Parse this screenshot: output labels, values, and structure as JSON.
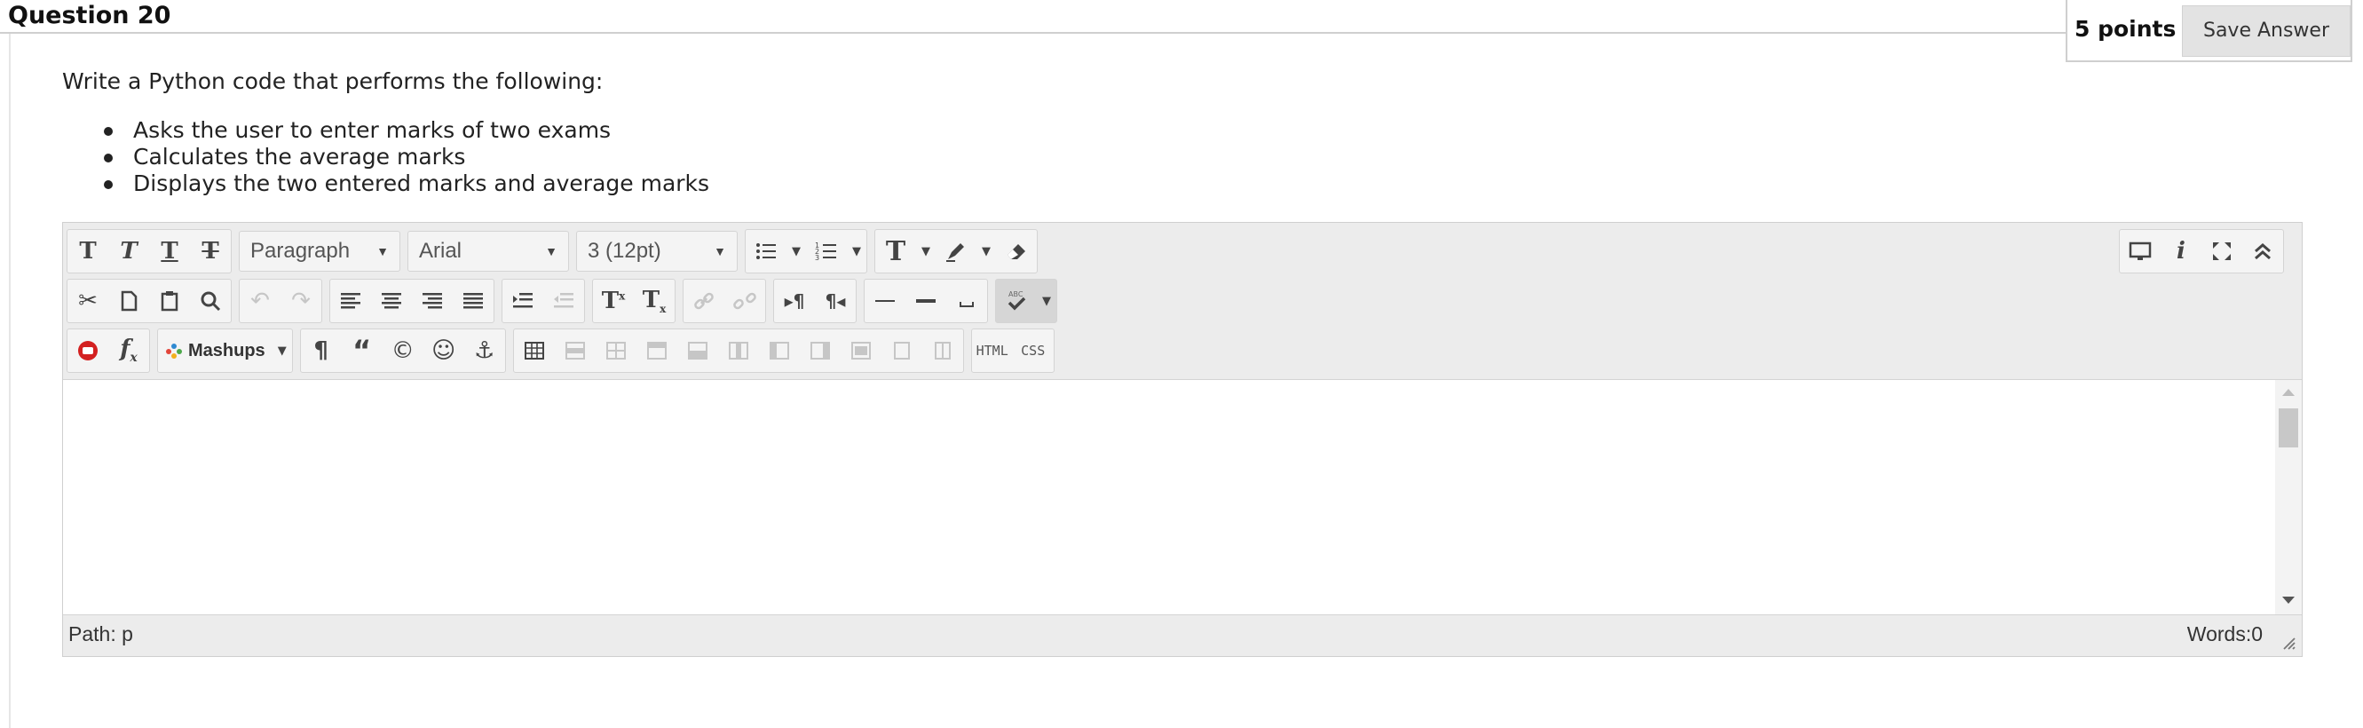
{
  "question": {
    "title": "Question 20",
    "points": "5 points",
    "save_label": "Save Answer",
    "prompt": "Write a Python code that performs the following:",
    "bullets": [
      "Asks the user to enter marks of two exams",
      "Calculates the average marks",
      "Displays the two entered marks and average marks"
    ]
  },
  "editor": {
    "format_select": "Paragraph",
    "font_select": "Arial",
    "size_select": "3 (12pt)",
    "mashups_label": "Mashups",
    "html_label": "HTML",
    "css_label": "CSS",
    "path_label": "Path: p",
    "words_label": "Words:0"
  },
  "colors": {
    "toolbar_bg": "#ececec",
    "button_bg": "#e3e3e3",
    "youtube_red": "#d32020"
  },
  "icons": [
    "bold-icon",
    "italic-icon",
    "underline-icon",
    "strikethrough-icon",
    "bullet-list-icon",
    "numbered-list-icon",
    "text-color-icon",
    "highlight-icon",
    "eraser-icon",
    "preview-icon",
    "info-icon",
    "fullscreen-icon",
    "collapse-icon",
    "cut-icon",
    "copy-icon",
    "paste-icon",
    "find-icon",
    "undo-icon",
    "redo-icon",
    "align-left-icon",
    "align-center-icon",
    "align-right-icon",
    "justify-icon",
    "indent-icon",
    "outdent-icon",
    "superscript-icon",
    "subscript-icon",
    "link-icon",
    "unlink-icon",
    "ltr-icon",
    "rtl-icon",
    "horizontal-rule-icon",
    "thick-rule-icon",
    "nonbreaking-space-icon",
    "spellcheck-icon",
    "youtube-icon",
    "formula-icon",
    "paragraph-mark-icon",
    "blockquote-icon",
    "copyright-icon",
    "emoticon-icon",
    "anchor-icon",
    "table-icon"
  ]
}
